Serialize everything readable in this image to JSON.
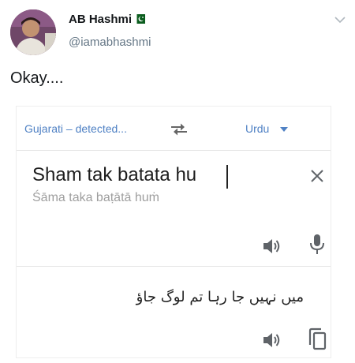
{
  "tweet": {
    "display_name": "AB Hashmi",
    "username": "@iamabhashmi",
    "text": "Okay....",
    "flag_icon": "pakistan-flag-icon",
    "menu_icon": "chevron-down-icon"
  },
  "translate": {
    "source_language": "Gujarati – detected...",
    "target_language": "Urdu",
    "swap_icon": "swap-arrows-icon",
    "input_text": "Sham tak batata hu",
    "transliteration": "Śāma taka baṭātā huṁ",
    "translation": "میں نہیں جا رہا تم لوگ جاؤ",
    "icons": [
      "close-icon",
      "speaker-icon",
      "microphone-icon",
      "copy-icon"
    ],
    "accent_color": "#4f81c4"
  }
}
